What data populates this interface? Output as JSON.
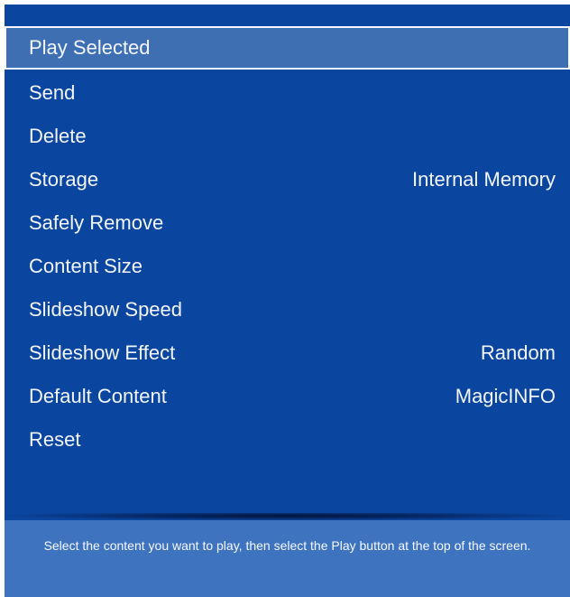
{
  "menu": {
    "items": [
      {
        "label": "Play Selected",
        "value": ""
      },
      {
        "label": "Send",
        "value": ""
      },
      {
        "label": "Delete",
        "value": ""
      },
      {
        "label": "Storage",
        "value": "Internal Memory"
      },
      {
        "label": "Safely Remove",
        "value": ""
      },
      {
        "label": "Content Size",
        "value": ""
      },
      {
        "label": "Slideshow Speed",
        "value": ""
      },
      {
        "label": "Slideshow Effect",
        "value": "Random"
      },
      {
        "label": "Default Content",
        "value": "MagicINFO"
      },
      {
        "label": "Reset",
        "value": ""
      }
    ]
  },
  "footer": {
    "help_text": "Select the content you want to play, then select the Play button at the top of the screen."
  },
  "colors": {
    "panel_bg": "#0a459f",
    "selected_bg": "#3e6fb3",
    "footer_bg": "#3d73bf",
    "text": "#f3f6fb"
  }
}
